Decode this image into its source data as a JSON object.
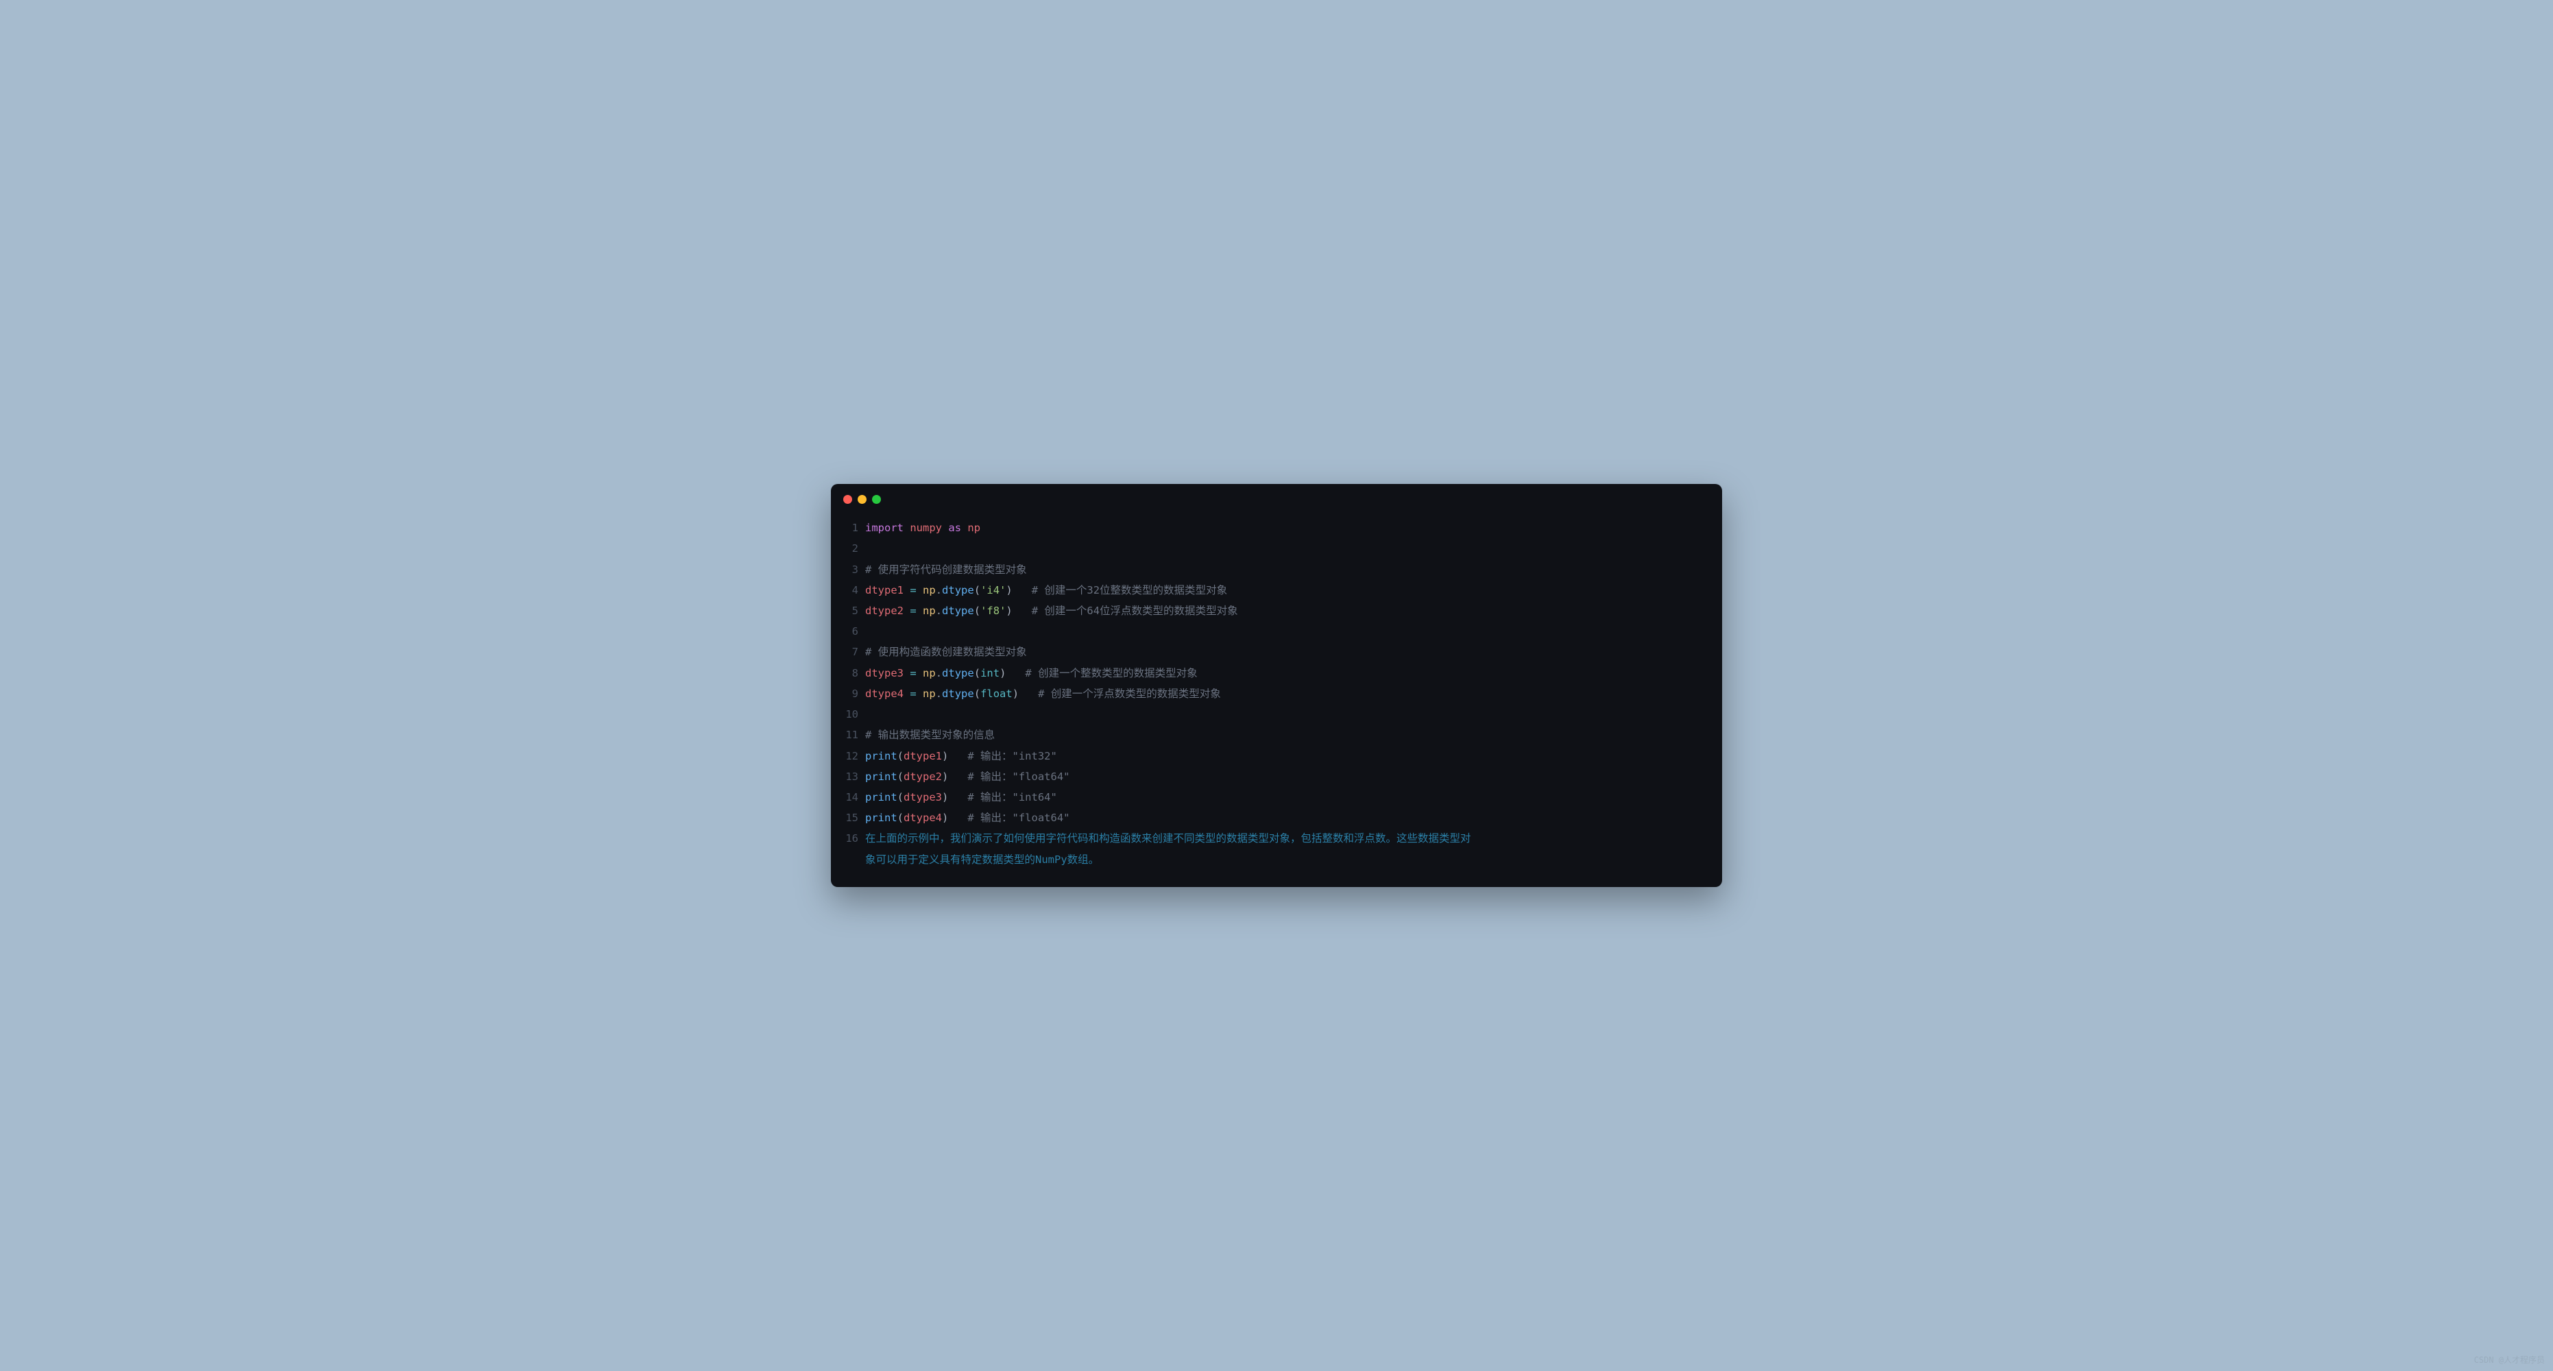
{
  "window": {
    "traffic_lights": [
      "close",
      "minimize",
      "maximize"
    ]
  },
  "code": {
    "lines": {
      "l1": {
        "num": "1",
        "import_kw": "import",
        "module": "numpy",
        "as_kw": "as",
        "alias": "np"
      },
      "l2": {
        "num": "2"
      },
      "l3": {
        "num": "3",
        "comment": "# 使用字符代码创建数据类型对象"
      },
      "l4": {
        "num": "4",
        "var": "dtype1",
        "eq": "=",
        "obj": "np",
        "dot": ".",
        "method": "dtype",
        "lp": "(",
        "arg": "'i4'",
        "rp": ")",
        "comment": "# 创建一个32位整数类型的数据类型对象"
      },
      "l5": {
        "num": "5",
        "var": "dtype2",
        "eq": "=",
        "obj": "np",
        "dot": ".",
        "method": "dtype",
        "lp": "(",
        "arg": "'f8'",
        "rp": ")",
        "comment": "# 创建一个64位浮点数类型的数据类型对象"
      },
      "l6": {
        "num": "6"
      },
      "l7": {
        "num": "7",
        "comment": "# 使用构造函数创建数据类型对象"
      },
      "l8": {
        "num": "8",
        "var": "dtype3",
        "eq": "=",
        "obj": "np",
        "dot": ".",
        "method": "dtype",
        "lp": "(",
        "arg": "int",
        "rp": ")",
        "comment": "# 创建一个整数类型的数据类型对象"
      },
      "l9": {
        "num": "9",
        "var": "dtype4",
        "eq": "=",
        "obj": "np",
        "dot": ".",
        "method": "dtype",
        "lp": "(",
        "arg": "float",
        "rp": ")",
        "comment": "# 创建一个浮点数类型的数据类型对象"
      },
      "l10": {
        "num": "10"
      },
      "l11": {
        "num": "11",
        "comment": "# 输出数据类型对象的信息"
      },
      "l12": {
        "num": "12",
        "func": "print",
        "lp": "(",
        "arg": "dtype1",
        "rp": ")",
        "comment": "# 输出：\"int32\""
      },
      "l13": {
        "num": "13",
        "func": "print",
        "lp": "(",
        "arg": "dtype2",
        "rp": ")",
        "comment": "# 输出：\"float64\""
      },
      "l14": {
        "num": "14",
        "func": "print",
        "lp": "(",
        "arg": "dtype3",
        "rp": ")",
        "comment": "# 输出：\"int64\""
      },
      "l15": {
        "num": "15",
        "func": "print",
        "lp": "(",
        "arg": "dtype4",
        "rp": ")",
        "comment": "# 输出：\"float64\""
      },
      "l16": {
        "num": "16",
        "text_a": "在上面的示例中，我们演示了如何使用字符代码和构造函数来创建不同类型的数据类型对象，包括整数和浮点数。这些数据类型对",
        "text_b": "象可以用于定义具有特定数据类型的NumPy数组。"
      }
    }
  },
  "watermark": "CSDN @人才程序员"
}
